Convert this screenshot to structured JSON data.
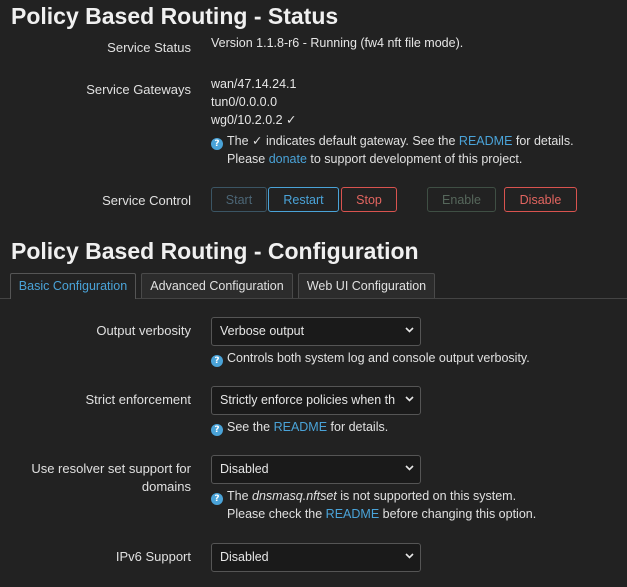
{
  "status": {
    "title": "Policy Based Routing - Status",
    "service_status_label": "Service Status",
    "service_status_value": "Version 1.1.8-r6 - Running (fw4 nft file mode).",
    "gateways_label": "Service Gateways",
    "gateways": [
      "wan/47.14.24.1",
      "tun0/0.0.0.0",
      "wg0/10.2.0.2 ✓"
    ],
    "gw_help_1a": "The ✓ indicates default gateway. See the ",
    "gw_help_1_link": "README",
    "gw_help_1b": " for details.",
    "gw_help_2a": "Please ",
    "gw_help_2_link": "donate",
    "gw_help_2b": " to support development of this project.",
    "control_label": "Service Control",
    "buttons": {
      "start": "Start",
      "restart": "Restart",
      "stop": "Stop",
      "enable": "Enable",
      "disable": "Disable"
    }
  },
  "config": {
    "title": "Policy Based Routing - Configuration",
    "tabs": [
      "Basic Configuration",
      "Advanced Configuration",
      "Web UI Configuration"
    ],
    "active_tab": 0,
    "verbosity_label": "Output verbosity",
    "verbosity_value": "Verbose output",
    "verbosity_help": "Controls both system log and console output verbosity.",
    "strict_label": "Strict enforcement",
    "strict_value": "Strictly enforce policies when th",
    "strict_help_a": "See the ",
    "strict_help_link": "README",
    "strict_help_b": " for details.",
    "resolver_label_1": "Use resolver set support for",
    "resolver_label_2": "domains",
    "resolver_value": "Disabled",
    "resolver_help_1a": "The ",
    "resolver_help_1_em": "dnsmasq.nftset",
    "resolver_help_1b": " is not supported on this system.",
    "resolver_help_2a": "Please check the ",
    "resolver_help_2_link": "README",
    "resolver_help_2b": " before changing this option.",
    "ipv6_label": "IPv6 Support",
    "ipv6_value": "Disabled"
  },
  "colors": {
    "background": "#222222",
    "accent": "#4aa3d8",
    "danger": "#d9534f"
  }
}
